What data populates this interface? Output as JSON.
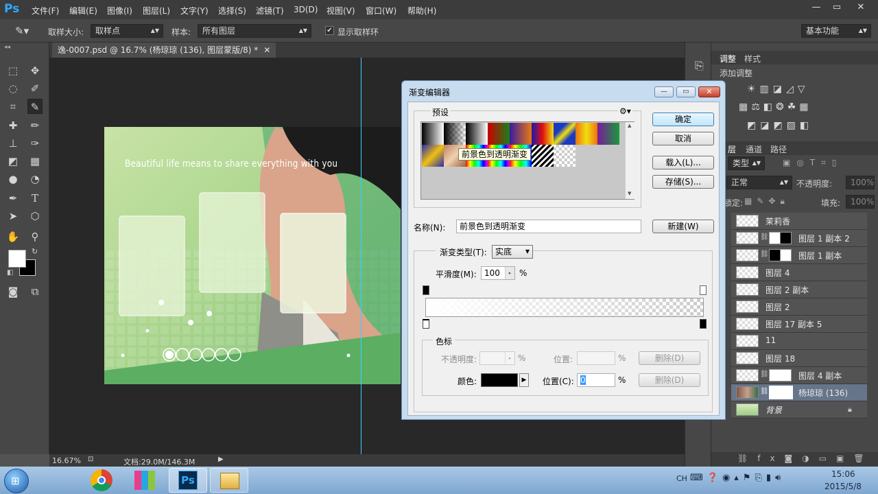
{
  "app": {
    "logo": "Ps"
  },
  "menu": [
    "文件(F)",
    "编辑(E)",
    "图像(I)",
    "图层(L)",
    "文字(Y)",
    "选择(S)",
    "滤镜(T)",
    "3D(D)",
    "视图(V)",
    "窗口(W)",
    "帮助(H)"
  ],
  "window_controls": {
    "minimize": "—",
    "restore": "▭",
    "close": "✕"
  },
  "options": {
    "sample_size_label": "取样大小:",
    "sample_size_value": "取样点",
    "sample_label": "样本:",
    "sample_value": "所有图层",
    "show_ring_label": "显示取样环",
    "show_ring_checked": true,
    "workspace": "基本功能"
  },
  "document": {
    "tab_title": "逸-0007.psd @ 16.7% (杨琼琼 (136), 图层蒙版/8) *",
    "zoom": "16.67%",
    "doc_info": "文档:29.0M/146.3M",
    "photo_text": "Beautiful life means to share everything with you"
  },
  "panels": {
    "adjust_tab": "调整",
    "style_tab": "样式",
    "add_adjust": "添加调整",
    "layers_tab": "层",
    "channels_tab": "通道",
    "paths_tab": "路径",
    "filter_kind": "类型",
    "blend_mode": "正常",
    "opacity_label": "不透明度:",
    "opacity_value": "100%",
    "lock_label": "锁定:",
    "fill_label": "填充:",
    "fill_value": "100%"
  },
  "layers": [
    {
      "name": "茉莉香",
      "mask": false,
      "selected": false
    },
    {
      "name": "图层 1 副本 2",
      "mask": true,
      "selected": false
    },
    {
      "name": "图层 1 副本",
      "mask": true,
      "selected": false
    },
    {
      "name": "图层 4",
      "mask": false,
      "selected": false
    },
    {
      "name": "图层 2 副本",
      "mask": false,
      "selected": false
    },
    {
      "name": "图层 2",
      "mask": false,
      "selected": false
    },
    {
      "name": "图层 17 副本 5",
      "mask": false,
      "selected": false
    },
    {
      "name": "11",
      "mask": false,
      "selected": false
    },
    {
      "name": "图层 18",
      "mask": false,
      "selected": false
    },
    {
      "name": "图层 4 副本",
      "mask": true,
      "selected": false
    },
    {
      "name": "杨琼琼 (136)",
      "mask": true,
      "selected": true
    },
    {
      "name": "背景",
      "mask": false,
      "selected": false
    }
  ],
  "dialog": {
    "title": "渐变编辑器",
    "presets_label": "预设",
    "tooltip": "前景色到透明渐变",
    "ok": "确定",
    "cancel": "取消",
    "load": "载入(L)...",
    "save": "存储(S)...",
    "name_label": "名称(N):",
    "name_value": "前景色到透明渐变",
    "new": "新建(W)",
    "gradient_type_label": "渐变类型(T):",
    "gradient_type_value": "实底",
    "smoothness_label": "平滑度(M):",
    "smoothness_value": "100",
    "percent": "%",
    "stops_label": "色标",
    "opacity_label": "不透明度:",
    "location_label_dis": "位置:",
    "delete": "删除(D)",
    "color_label": "颜色:",
    "location_label": "位置(C):",
    "location_value": "0",
    "stop_color": "#000000"
  },
  "taskbar": {
    "lang": "CH",
    "time": "15:06",
    "date": "2015/5/8"
  }
}
